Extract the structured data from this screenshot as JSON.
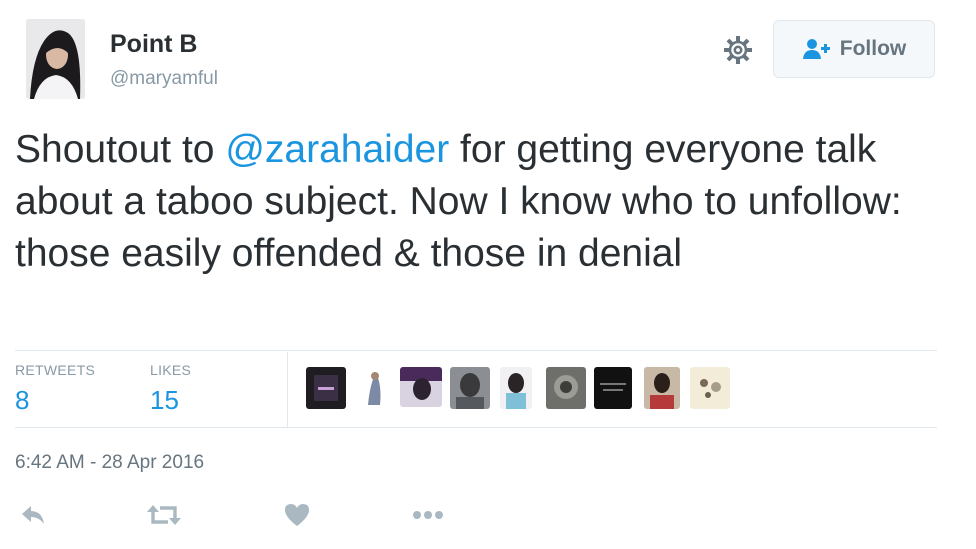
{
  "user": {
    "name": "Point B",
    "handle": "@maryamful"
  },
  "actions_top": {
    "follow_label": "Follow",
    "gear_icon": "gear-icon"
  },
  "tweet": {
    "text_before": "Shoutout to ",
    "mention": "@zarahaider",
    "text_after": " for getting everyone talk about a taboo subject. Now I know who to unfollow: those easily offended & those in denial"
  },
  "stats": {
    "retweets_label": "RETWEETS",
    "retweets_value": "8",
    "likes_label": "LIKES",
    "likes_value": "15"
  },
  "timestamp": "6:42 AM - 28 Apr 2016",
  "action_icons": [
    "reply-icon",
    "retweet-icon",
    "like-icon",
    "more-icon"
  ],
  "colors": {
    "link": "#1b95e0",
    "muted": "#8899a6",
    "text": "#292f33",
    "action_icon": "#aab8c2"
  }
}
